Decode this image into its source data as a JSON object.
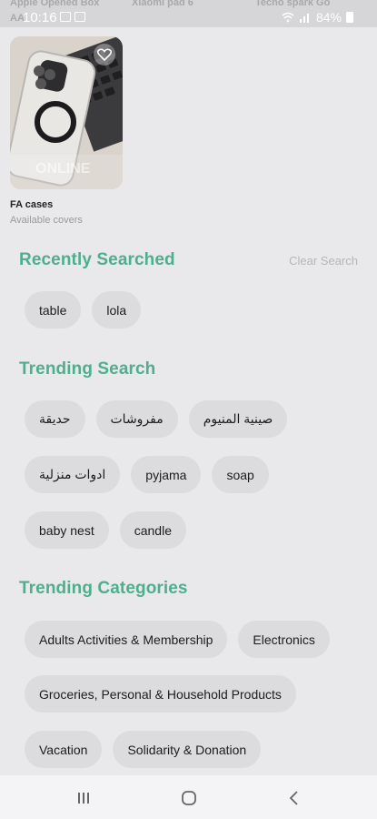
{
  "status_bar": {
    "time": "10:16",
    "battery": "84%",
    "ghost_tabs": [
      "Apple Opened Box",
      "Xiaomi pad 6",
      "Tecno spark Go"
    ],
    "ghost_sub": "AA"
  },
  "product": {
    "name": "FA cases",
    "subtitle": "Available covers",
    "watermark": "ONLINE"
  },
  "recent": {
    "title": "Recently Searched",
    "clear_label": "Clear Search",
    "chips": [
      "table",
      "lola"
    ]
  },
  "trending_search": {
    "title": "Trending Search",
    "chips": [
      "حديقة",
      "مفروشات",
      "صينية المنيوم",
      "ادوات منزلية",
      "pyjama",
      "soap",
      "baby nest",
      "candle"
    ]
  },
  "trending_categories": {
    "title": "Trending Categories",
    "chips": [
      "Adults Activities & Membership",
      "Electronics",
      "Groceries, Personal & Household Products",
      "Vacation",
      "Solidarity & Donation"
    ]
  },
  "colors": {
    "accent": "#4fae8c",
    "chip_bg": "#dcdcde",
    "page_bg": "#e9e9eb"
  },
  "nav": {
    "icons": [
      "recent-apps-icon",
      "home-icon",
      "back-icon"
    ]
  }
}
